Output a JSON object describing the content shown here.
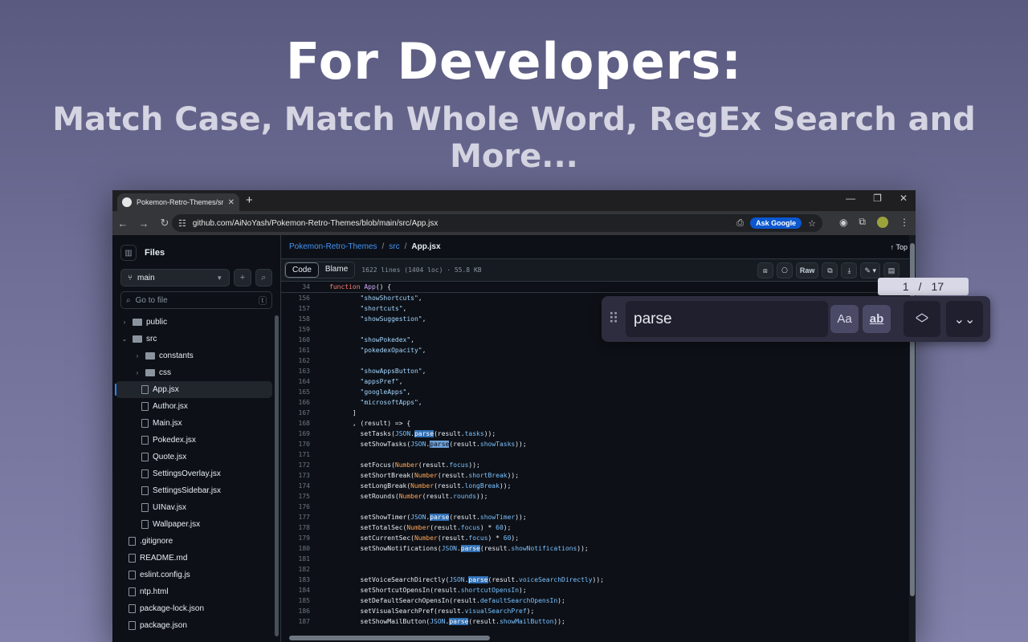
{
  "banner": {
    "title": "For Developers:",
    "subtitle": "Match Case, Match Whole Word, RegEx Search and More..."
  },
  "browser": {
    "tab_title": "Pokemon-Retro-Themes/src/Ap",
    "url": "github.com/AiNoYash/Pokemon-Retro-Themes/blob/main/src/App.jsx",
    "ask_google": "Ask Google"
  },
  "sidebar": {
    "title": "Files",
    "branch": "main",
    "goto_placeholder": "Go to file",
    "goto_key": "t",
    "tree": [
      {
        "label": "public",
        "type": "folder",
        "depth": 0,
        "expanded": false
      },
      {
        "label": "src",
        "type": "folder",
        "depth": 0,
        "expanded": true
      },
      {
        "label": "constants",
        "type": "folder",
        "depth": 1,
        "expanded": false
      },
      {
        "label": "css",
        "type": "folder",
        "depth": 1,
        "expanded": false
      },
      {
        "label": "App.jsx",
        "type": "file",
        "depth": 1,
        "selected": true
      },
      {
        "label": "Author.jsx",
        "type": "file",
        "depth": 1
      },
      {
        "label": "Main.jsx",
        "type": "file",
        "depth": 1
      },
      {
        "label": "Pokedex.jsx",
        "type": "file",
        "depth": 1
      },
      {
        "label": "Quote.jsx",
        "type": "file",
        "depth": 1
      },
      {
        "label": "SettingsOverlay.jsx",
        "type": "file",
        "depth": 1
      },
      {
        "label": "SettingsSidebar.jsx",
        "type": "file",
        "depth": 1
      },
      {
        "label": "UINav.jsx",
        "type": "file",
        "depth": 1
      },
      {
        "label": "Wallpaper.jsx",
        "type": "file",
        "depth": 1
      },
      {
        "label": ".gitignore",
        "type": "file",
        "depth": 0
      },
      {
        "label": "README.md",
        "type": "file",
        "depth": 0
      },
      {
        "label": "eslint.config.js",
        "type": "file",
        "depth": 0
      },
      {
        "label": "ntp.html",
        "type": "file",
        "depth": 0
      },
      {
        "label": "package-lock.json",
        "type": "file",
        "depth": 0
      },
      {
        "label": "package.json",
        "type": "file",
        "depth": 0
      }
    ]
  },
  "breadcrumb": {
    "repo": "Pokemon-Retro-Themes",
    "folder": "src",
    "file": "App.jsx",
    "top": "↑ Top"
  },
  "filebar": {
    "code_tab": "Code",
    "blame_tab": "Blame",
    "meta": "1622 lines (1404 loc) · 55.8 KB",
    "raw": "Raw"
  },
  "code": {
    "sticky_line": "34",
    "lines": [
      {
        "n": "156",
        "html": "        <span class=\"s\">\"showShortcuts\"</span>,"
      },
      {
        "n": "157",
        "html": "        <span class=\"s\">\"shortcuts\"</span>,"
      },
      {
        "n": "158",
        "html": "        <span class=\"s\">\"showSuggestion\"</span>,"
      },
      {
        "n": "159",
        "html": ""
      },
      {
        "n": "160",
        "html": "        <span class=\"s\">\"showPokedex\"</span>,"
      },
      {
        "n": "161",
        "html": "        <span class=\"s\">\"pokedexOpacity\"</span>,"
      },
      {
        "n": "162",
        "html": ""
      },
      {
        "n": "163",
        "html": "        <span class=\"s\">\"showAppsButton\"</span>,"
      },
      {
        "n": "164",
        "html": "        <span class=\"s\">\"appsPref\"</span>,"
      },
      {
        "n": "165",
        "html": "        <span class=\"s\">\"googleApps\"</span>,"
      },
      {
        "n": "166",
        "html": "        <span class=\"s\">\"microsoftApps\"</span>,"
      },
      {
        "n": "167",
        "html": "      ]"
      },
      {
        "n": "168",
        "html": "      , (result) => {"
      },
      {
        "n": "169",
        "html": "        setTasks(<span class=\"pr\">JSON</span>.<span class=\"hl\">parse</span>(result.<span class=\"pr\">tasks</span>));"
      },
      {
        "n": "170",
        "html": "        setShowTasks(<span class=\"pr\">JSON</span>.<span class=\"hlb\">parse</span>(result.<span class=\"pr\">showTasks</span>));"
      },
      {
        "n": "171",
        "html": ""
      },
      {
        "n": "172",
        "html": "        setFocus(<span class=\"b\">Number</span>(result.<span class=\"pr\">focus</span>));"
      },
      {
        "n": "173",
        "html": "        setShortBreak(<span class=\"b\">Number</span>(result.<span class=\"pr\">shortBreak</span>));"
      },
      {
        "n": "174",
        "html": "        setLongBreak(<span class=\"b\">Number</span>(result.<span class=\"pr\">longBreak</span>));"
      },
      {
        "n": "175",
        "html": "        setRounds(<span class=\"b\">Number</span>(result.<span class=\"pr\">rounds</span>));"
      },
      {
        "n": "176",
        "html": ""
      },
      {
        "n": "177",
        "html": "        setShowTimer(<span class=\"pr\">JSON</span>.<span class=\"hl\">parse</span>(result.<span class=\"pr\">showTimer</span>));"
      },
      {
        "n": "178",
        "html": "        setTotalSec(<span class=\"b\">Number</span>(result.<span class=\"pr\">focus</span>) * <span class=\"pr\">60</span>);"
      },
      {
        "n": "179",
        "html": "        setCurrentSec(<span class=\"b\">Number</span>(result.<span class=\"pr\">focus</span>) * <span class=\"pr\">60</span>);"
      },
      {
        "n": "180",
        "html": "        setShowNotifications(<span class=\"pr\">JSON</span>.<span class=\"hl\">parse</span>(result.<span class=\"pr\">showNotifications</span>));"
      },
      {
        "n": "181",
        "html": ""
      },
      {
        "n": "182",
        "html": ""
      },
      {
        "n": "183",
        "html": "        setVoiceSearchDirectly(<span class=\"pr\">JSON</span>.<span class=\"hl\">parse</span>(result.<span class=\"pr\">voiceSearchDirectly</span>));"
      },
      {
        "n": "184",
        "html": "        setShortcutOpensIn(result.<span class=\"pr\">shortcutOpensIn</span>);"
      },
      {
        "n": "185",
        "html": "        setDefaultSearchOpensIn(result.<span class=\"pr\">defaultSearchOpensIn</span>);"
      },
      {
        "n": "186",
        "html": "        setVisualSearchPref(result.<span class=\"pr\">visualSearchPref</span>);"
      },
      {
        "n": "187",
        "html": "        setShowMailButton(<span class=\"pr\">JSON</span>.<span class=\"hl\">parse</span>(result.<span class=\"pr\">showMailButton</span>));"
      }
    ]
  },
  "find": {
    "query": "parse",
    "current": "1",
    "separator": "/",
    "total": "17",
    "match_case_label": "Aa",
    "whole_word_label": "ab"
  }
}
